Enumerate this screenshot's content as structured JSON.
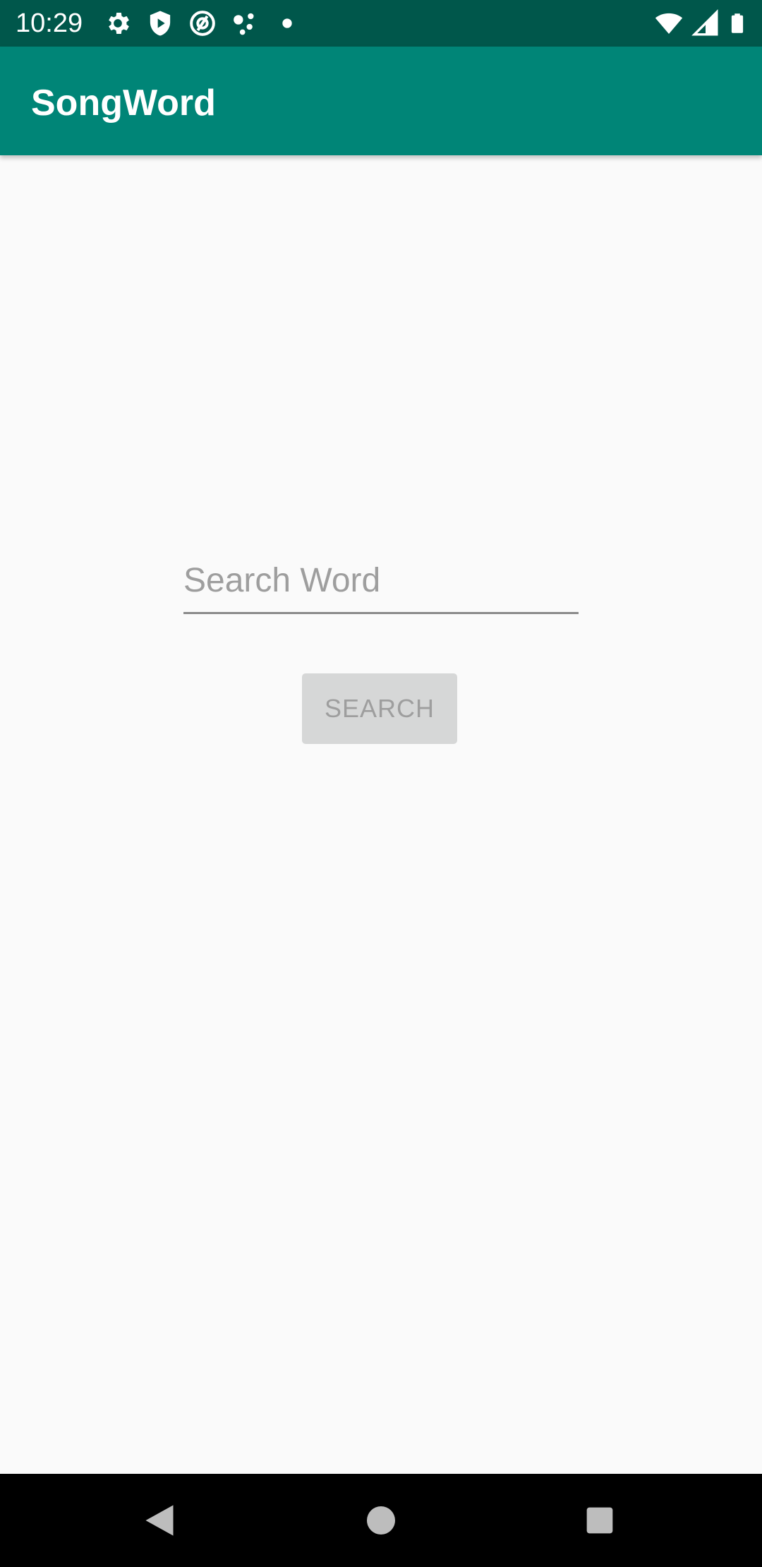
{
  "status_bar": {
    "time": "10:29",
    "icons_left": [
      "gear-icon",
      "shield-play-icon",
      "at-circle-icon",
      "dots-network-icon",
      "dot-icon"
    ],
    "icons_right": [
      "wifi-icon",
      "signal-icon",
      "battery-icon"
    ],
    "background": "#00574b"
  },
  "app_bar": {
    "title": "SongWord",
    "background": "#008577"
  },
  "search": {
    "placeholder": "Search Word",
    "value": "",
    "button_label": "SEARCH"
  },
  "nav_bar": {
    "icons": [
      "back-icon",
      "home-icon",
      "recents-icon"
    ]
  }
}
